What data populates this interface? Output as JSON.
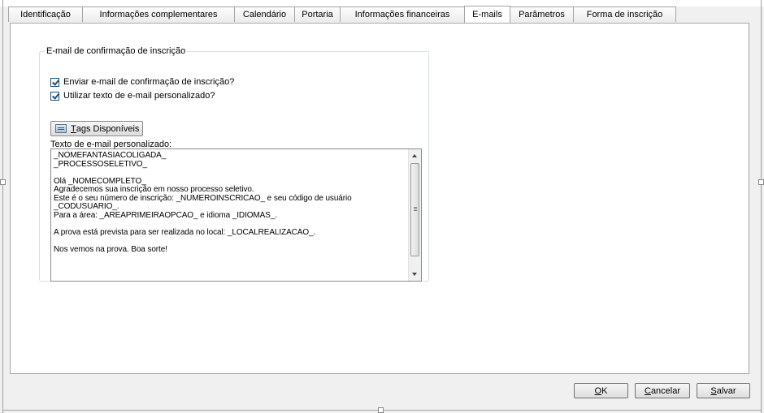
{
  "tabs": [
    {
      "label": "Identificação",
      "active": false
    },
    {
      "label": "Informações complementares",
      "active": false
    },
    {
      "label": "Calendário",
      "active": false
    },
    {
      "label": "Portaria",
      "active": false
    },
    {
      "label": "Informações financeiras",
      "active": false
    },
    {
      "label": "E-mails",
      "active": true
    },
    {
      "label": "Parâmetros",
      "active": false
    },
    {
      "label": "Forma de inscrição",
      "active": false
    }
  ],
  "group": {
    "legend": "E-mail de confirmação de inscrição",
    "checkbox_send": {
      "label": "Enviar e-mail de confirmação de inscrição?",
      "checked": true
    },
    "checkbox_custom": {
      "label": "Utilizar texto de e-mail personalizado?",
      "checked": true
    },
    "tags_button": {
      "accel": "T",
      "label_rest": "ags Disponíveis",
      "icon": "tags-list-icon"
    },
    "textarea_label": "Texto de e-mail personalizado:",
    "textarea_value": "_NOMEFANTASIACOLIGADA_\n_PROCESSOSELETIVO_\n\nOlá _NOMECOMPLETO_\nAgradecemos sua inscrição em nosso processo seletivo.\nEste é o seu número de inscrição: _NUMEROINSCRICAO_ e seu código de usuário\n_CODUSUARIO_.\nPara a área: _AREAPRIMEIRAOPCAO_ e idioma _IDIOMAS_.\n\nA prova está prevista para ser realizada no local: _LOCALREALIZACAO_.\n\nNos vemos na prova. Boa sorte!"
  },
  "footer": {
    "ok": {
      "accel": "O",
      "rest": "K"
    },
    "cancel": {
      "accel": "C",
      "rest": "ancelar"
    },
    "save": {
      "accel": "S",
      "rest": "alvar"
    }
  }
}
